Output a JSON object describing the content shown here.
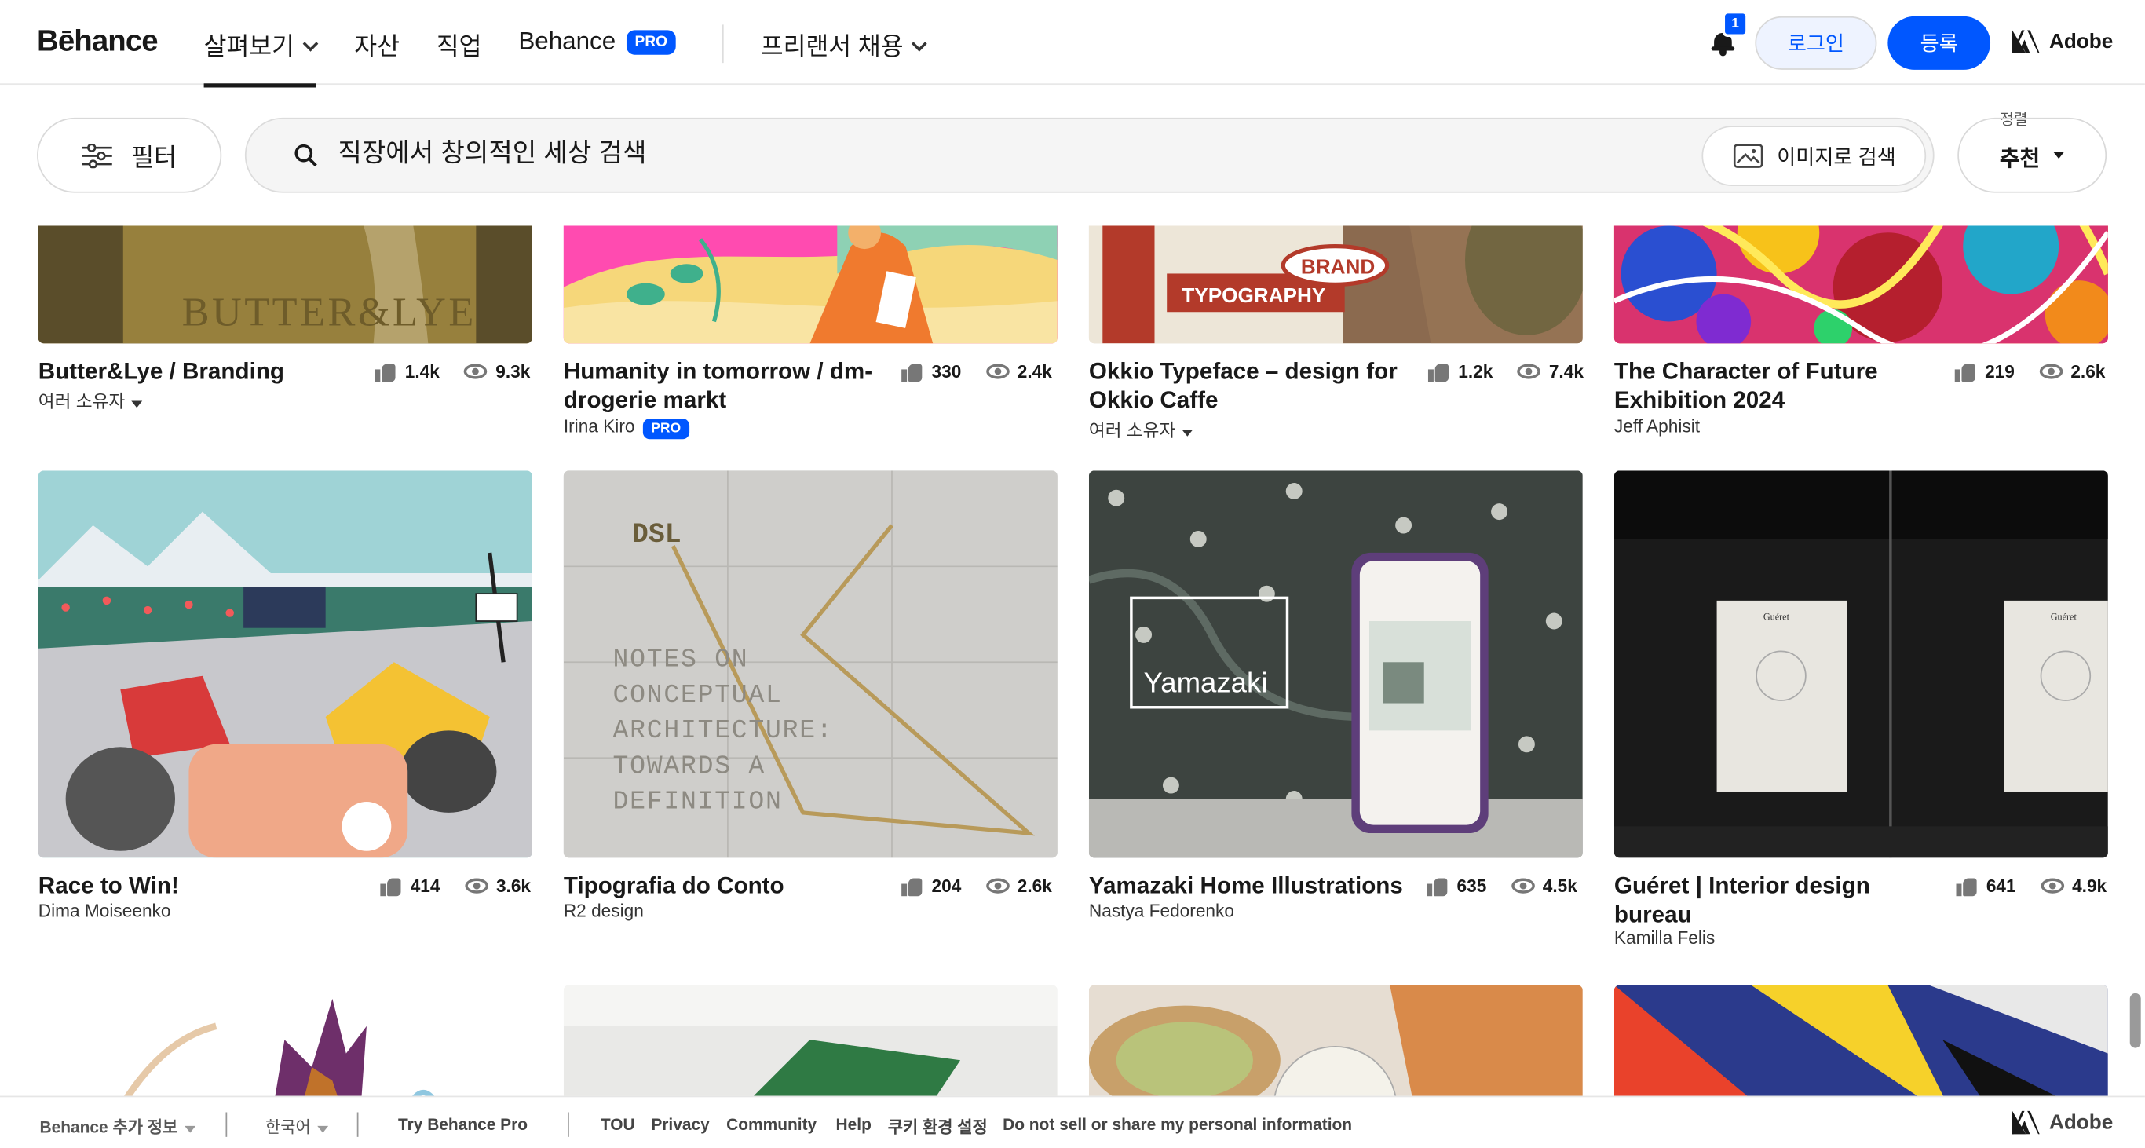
{
  "nav": {
    "logo": "Bēhance",
    "explore": "살펴보기",
    "assets": "자산",
    "jobs": "직업",
    "behance": "Behance",
    "pro": "PRO",
    "freelance": "프리랜서 채용",
    "notif_count": "1",
    "login": "로그인",
    "signup": "등록",
    "adobe": "Adobe"
  },
  "search": {
    "filter": "필터",
    "placeholder": "직장에서 창의적인 세상 검색",
    "image_search": "이미지로 검색",
    "sort_label": "정렬",
    "sort_value": "추천"
  },
  "cards": [
    {
      "title": "Butter&Lye / Branding",
      "owner": "여러 소유자",
      "likes": "1.4k",
      "views": "9.3k",
      "thumb_text": "BUTTER&LYE"
    },
    {
      "title": "Humanity in tomorrow / dm-drogerie markt",
      "owner": "Irina Kiro",
      "pro": "PRO",
      "likes": "330",
      "views": "2.4k"
    },
    {
      "title": "Okkio Typeface – design for Okkio Caffe",
      "owner": "여러 소유자",
      "likes": "1.2k",
      "views": "7.4k",
      "thumb_text": "TYPOGRAPHY",
      "thumb_text2": "BRAND"
    },
    {
      "title": "The Character of Future Exhibition 2024",
      "owner": "Jeff Aphisit",
      "likes": "219",
      "views": "2.6k"
    },
    {
      "title": "Race to Win!",
      "owner": "Dima Moiseenko",
      "likes": "414",
      "views": "3.6k"
    },
    {
      "title": "Tipografia do Conto",
      "owner": "R2 design",
      "likes": "204",
      "views": "2.6k",
      "thumb_text": "DSL",
      "thumb_lines": "NOTES ON CONCEPTUAL ARCHITECTURE: TOWARDS A DEFINITION"
    },
    {
      "title": "Yamazaki Home Illustrations",
      "owner": "Nastya Fedorenko",
      "likes": "635",
      "views": "4.5k",
      "thumb_text": "Yamazaki"
    },
    {
      "title": "Guéret | Interior design bureau",
      "owner": "Kamilla Felis",
      "likes": "641",
      "views": "4.9k",
      "thumb_text": "Guéret"
    }
  ],
  "footer": {
    "more": "Behance 추가 정보",
    "lang": "한국어",
    "pro": "Try Behance Pro",
    "tou": "TOU",
    "privacy": "Privacy",
    "community": "Community",
    "help": "Help",
    "cookie": "쿠키 환경 설정",
    "dns": "Do not sell or share my personal information",
    "adobe": "Adobe"
  }
}
